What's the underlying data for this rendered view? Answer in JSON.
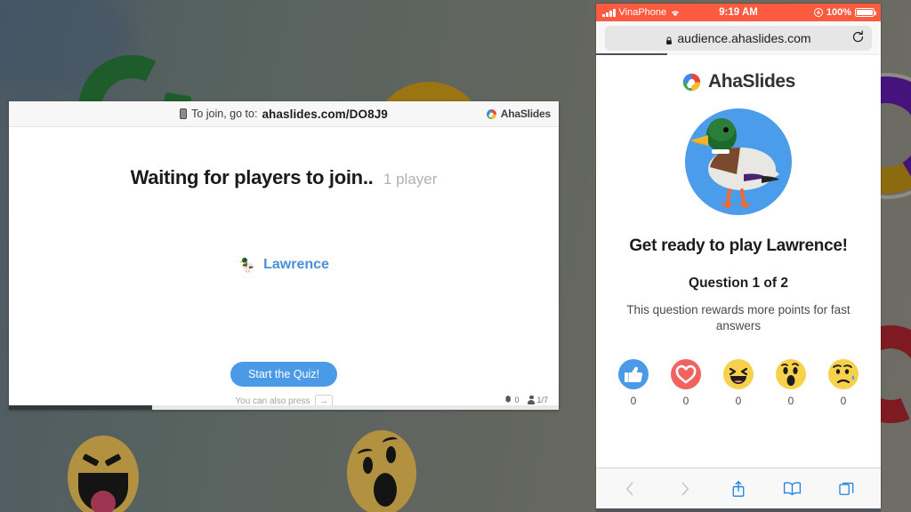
{
  "background": {
    "style": "blurred-slate-gradient-with-emoji-and-rings"
  },
  "presenter": {
    "header": {
      "phone_icon": "mobile-icon",
      "join_label": "To join, go to:",
      "join_code": "ahaslides.com/DO8J9",
      "brand": "AhaSlides",
      "brand_icon": "ahaslides-logo-icon"
    },
    "waiting_title": "Waiting for players to join..",
    "player_count": "1 player",
    "player": {
      "avatar_icon": "duck-avatar-icon",
      "name": "Lawrence"
    },
    "start_button": "Start the Quiz!",
    "press_hint": "You can also press",
    "press_key": "→",
    "status": {
      "hand_icon": "raised-hand-icon",
      "hand_count": "0",
      "person_icon": "person-icon",
      "person_count": "1/7"
    }
  },
  "phone": {
    "status_bar": {
      "signal_icon": "signal-bars-icon",
      "carrier": "VinaPhone",
      "wifi_icon": "wifi-icon",
      "time": "9:19 AM",
      "orientation_lock_icon": "rotation-lock-icon",
      "battery_percent": "100%",
      "battery_icon": "battery-full-icon"
    },
    "browser": {
      "lock_icon": "padlock-icon",
      "url": "audience.ahaslides.com",
      "reload_icon": "reload-icon",
      "progress": 25
    },
    "page": {
      "brand": "AhaSlides",
      "brand_icon": "ahaslides-logo-icon",
      "avatar_icon": "duck-avatar-icon",
      "get_ready": "Get ready to play Lawrence!",
      "question_number": "Question 1 of 2",
      "question_note": "This question rewards more points for fast answers",
      "reactions": [
        {
          "icon": "thumbs-up-icon",
          "emoji": "👍",
          "count": "0",
          "color": "#4a9ae8"
        },
        {
          "icon": "heart-icon",
          "emoji": "❤",
          "count": "0",
          "color": "#f2625f"
        },
        {
          "icon": "laugh-icon",
          "emoji": "😆",
          "count": "0",
          "color": "#f7d14c"
        },
        {
          "icon": "wow-icon",
          "emoji": "😮",
          "count": "0",
          "color": "#f7d14c"
        },
        {
          "icon": "sad-icon",
          "emoji": "😢",
          "count": "0",
          "color": "#f7d14c"
        }
      ]
    },
    "toolbar": {
      "back": "‹",
      "forward": "›",
      "share_icon": "share-icon",
      "bookmarks_icon": "book-icon",
      "tabs_icon": "tabs-icon"
    }
  },
  "colors": {
    "accent": "#4a9ae8",
    "status_bar": "#fc5b3f",
    "link": "#4a90d9"
  }
}
